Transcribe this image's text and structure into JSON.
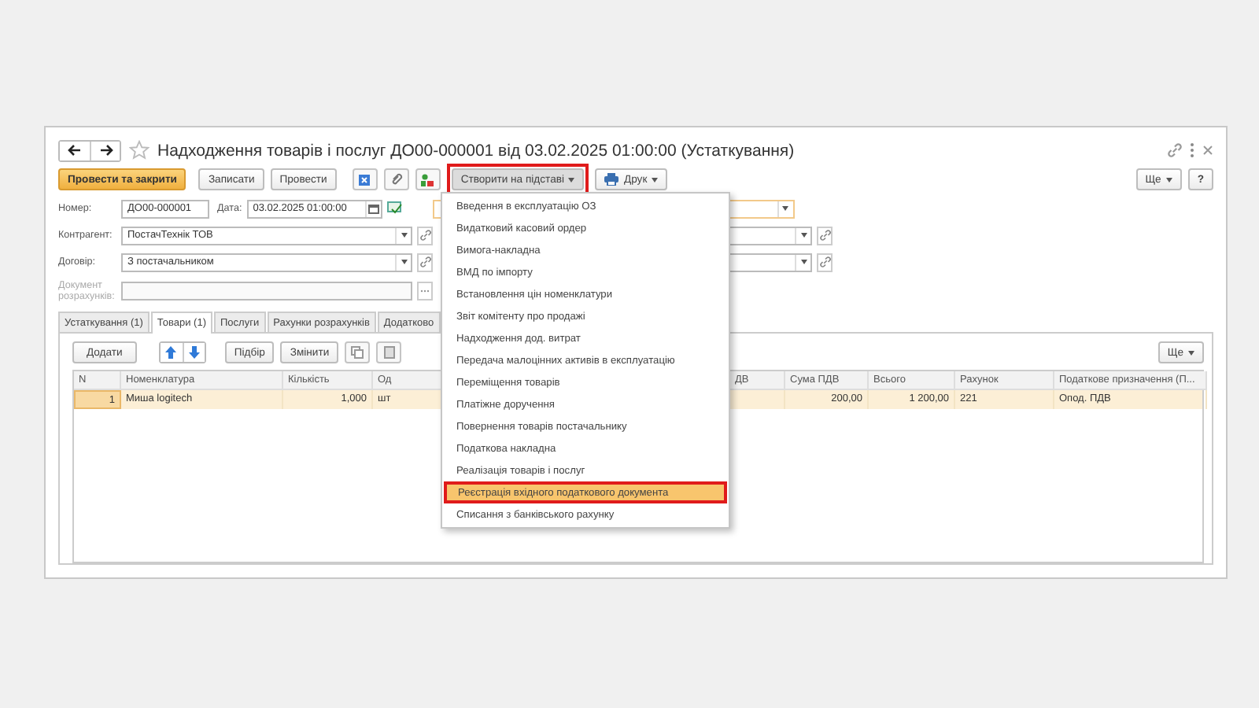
{
  "window": {
    "title": "Надходження товарів і послуг ДО00-000001 від 03.02.2025 01:00:00 (Устаткування)"
  },
  "toolbar": {
    "buttons": [
      {
        "label": "Провести та закрити",
        "kind": "primary"
      },
      {
        "label": "Записати",
        "kind": "plain"
      },
      {
        "label": "Провести",
        "kind": "plain"
      }
    ],
    "create_button": {
      "label": "Створити на підставі",
      "highlighted": true,
      "expanded": true
    },
    "print_button": {
      "label": "Друк"
    },
    "more_button": {
      "label": "Ще"
    },
    "help_button": {
      "label": "?"
    }
  },
  "fields": {
    "number": {
      "label": "Номер:",
      "value": "ДО00-000001"
    },
    "date": {
      "label": "Дата:",
      "value": "03.02.2025 01:00:00"
    },
    "counterparty": {
      "label": "Контрагент:",
      "value": "ПостачТехнік ТОВ"
    },
    "contract": {
      "label": "Договір:",
      "value": "З постачальником"
    },
    "settlement_document": {
      "label": "Документ розрахунків:",
      "disabled": true
    }
  },
  "tabs": [
    {
      "label": "Устаткування (1)",
      "selected": false
    },
    {
      "label": "Товари (1)",
      "selected": true
    },
    {
      "label": "Послуги",
      "selected": false
    },
    {
      "label": "Рахунки розрахунків",
      "selected": false
    },
    {
      "label": "Додатково",
      "selected": false
    }
  ],
  "table_toolbar": {
    "add_button": "Додати",
    "pick_button": "Підбір",
    "change_button": "Змінити",
    "more_button": "Ще"
  },
  "table": {
    "columns": [
      "N",
      "Номенклатура",
      "Кількість",
      "Од",
      "ДВ",
      "Сума ПДВ",
      "Всього",
      "Рахунок",
      "Податкове призначення (П..."
    ],
    "rows": [
      {
        "selected": true,
        "cells": [
          "1",
          "Миша logitech",
          "1,000",
          "шт",
          null,
          "200,00",
          "1 200,00",
          "221",
          "Опод. ПДВ"
        ]
      }
    ]
  },
  "create_menu": {
    "items": [
      {
        "label": "Введення в експлуатацію ОЗ",
        "selected": false
      },
      {
        "label": "Видатковий касовий ордер",
        "selected": false
      },
      {
        "label": "Вимога-накладна",
        "selected": false
      },
      {
        "label": "ВМД по імпорту",
        "selected": false
      },
      {
        "label": "Встановлення цін номенклатури",
        "selected": false
      },
      {
        "label": "Звіт комітенту про продажі",
        "selected": false
      },
      {
        "label": "Надходження дод. витрат",
        "selected": false
      },
      {
        "label": "Передача малоцінних активів в експлуатацію",
        "selected": false
      },
      {
        "label": "Переміщення товарів",
        "selected": false
      },
      {
        "label": "Платіжне доручення",
        "selected": false
      },
      {
        "label": "Повернення товарів постачальнику",
        "selected": false
      },
      {
        "label": "Податкова накладна",
        "selected": false
      },
      {
        "label": "Реалізація товарів і послуг",
        "selected": false
      },
      {
        "label": "Реєстрація вхідного податкового документа",
        "selected": true
      },
      {
        "label": "Списання з банківського рахунку",
        "selected": false
      }
    ]
  }
}
